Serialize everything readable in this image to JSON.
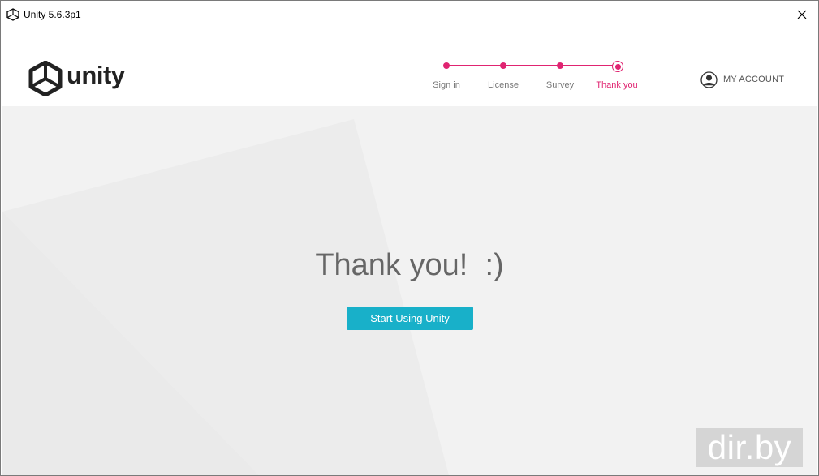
{
  "window": {
    "title": "Unity 5.6.3p1"
  },
  "header": {
    "logo_text": "unity",
    "steps": [
      {
        "label": "Sign in",
        "state": "done"
      },
      {
        "label": "License",
        "state": "done"
      },
      {
        "label": "Survey",
        "state": "done"
      },
      {
        "label": "Thank you",
        "state": "current"
      }
    ],
    "account_label": "MY ACCOUNT"
  },
  "main": {
    "heading": "Thank you!  :)",
    "button_label": "Start Using Unity"
  },
  "watermark": "dir.by",
  "colors": {
    "accent": "#e02471",
    "button": "#18b0c9",
    "background": "#f2f2f2"
  }
}
